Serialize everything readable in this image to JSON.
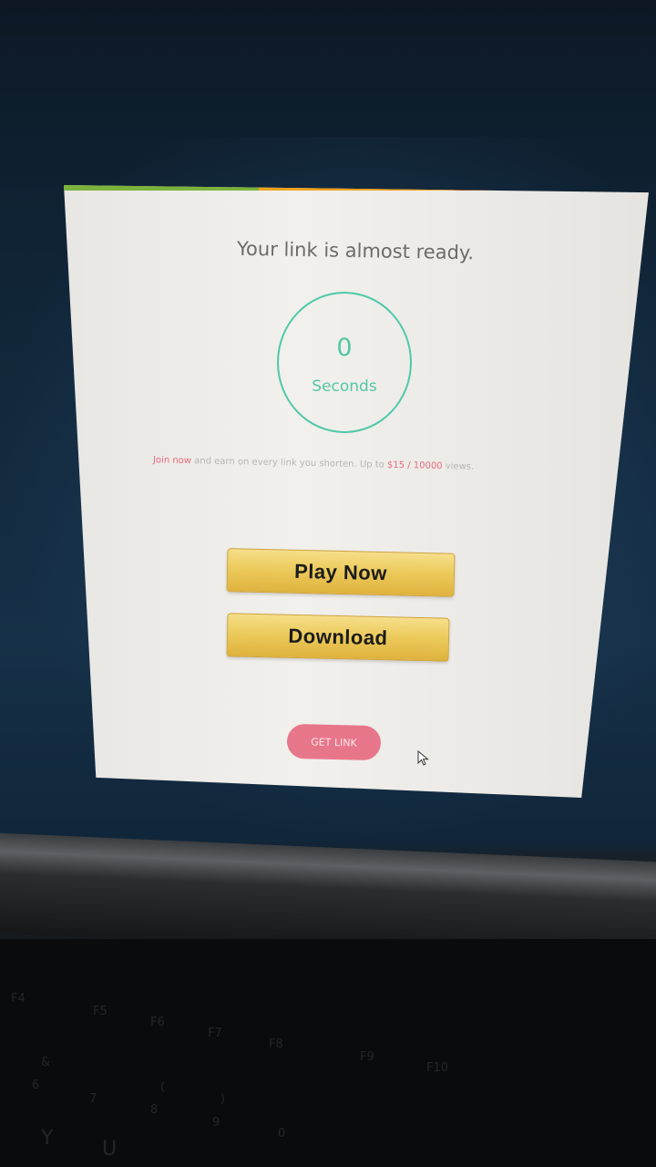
{
  "popup": {
    "title": "Your link is almost ready.",
    "timer": {
      "value": "0",
      "unit": "Seconds"
    },
    "promo": {
      "join": "Join now",
      "text": " and earn on every link you shorten. Up to ",
      "amount": "$15 / 10000",
      "views": " views."
    },
    "buttons": {
      "play_now": "Play Now",
      "download": "Download"
    },
    "get_link": "GET LINK",
    "colors": {
      "bar": [
        "#7bb33c",
        "#f0a21e",
        "#ec6a21"
      ],
      "timer": "#4ec9a8",
      "accent": "#e8697e",
      "gold": "#eccb5c"
    }
  },
  "keyboard": {
    "keys": [
      "F4",
      "F5",
      "F6",
      "F7",
      "F8",
      "F9",
      "F10",
      "&",
      "6",
      "7",
      "(",
      "8",
      ")",
      "9",
      "0",
      "Y",
      "U"
    ]
  },
  "icons": [
    "cursor-icon"
  ]
}
